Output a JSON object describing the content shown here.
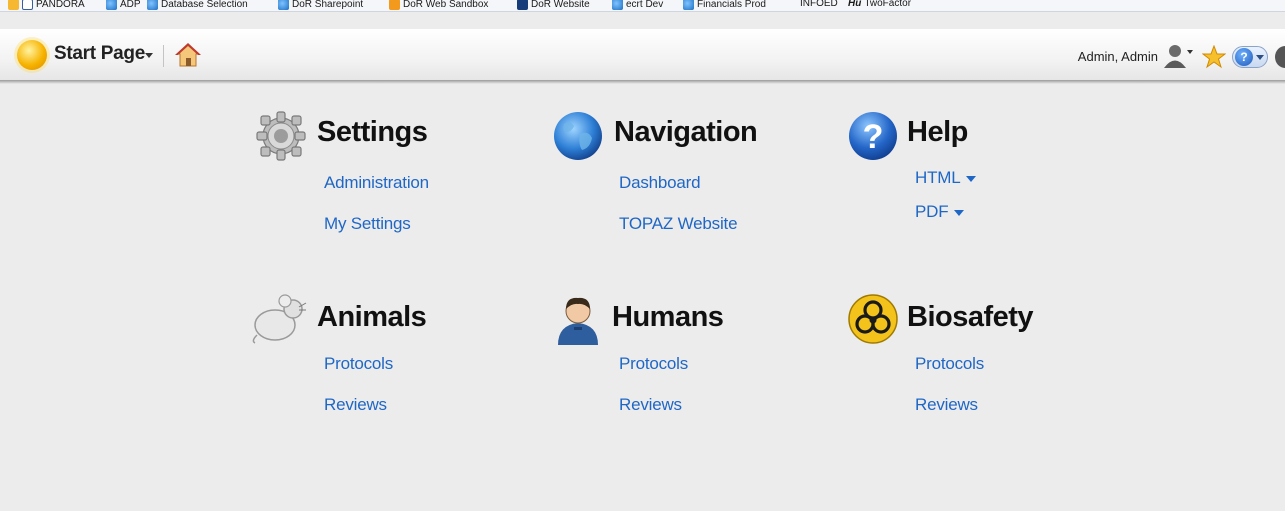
{
  "favorites_bar": {
    "items": [
      {
        "label": "PANDORA",
        "icon": "p-icon"
      },
      {
        "label": "ADP",
        "icon": "ie-icon"
      },
      {
        "label": "Database Selection",
        "icon": "ie-icon"
      },
      {
        "label": "DoR Sharepoint",
        "icon": "ie-icon"
      },
      {
        "label": "DoR Web Sandbox",
        "icon": "orange-icon"
      },
      {
        "label": "DoR Website",
        "icon": "hu-icon"
      },
      {
        "label": "ecrt Dev",
        "icon": "ie-icon"
      },
      {
        "label": "Financials Prod",
        "icon": "ie-icon"
      },
      {
        "label": "INFOED",
        "icon": ""
      },
      {
        "label": "TwoFactor",
        "icon": "hu-text-icon"
      }
    ]
  },
  "header": {
    "start_page_label": "Start Page",
    "user_name": "Admin, Admin"
  },
  "sections": {
    "settings": {
      "title": "Settings",
      "links": [
        "Administration",
        "My Settings"
      ]
    },
    "navigation": {
      "title": "Navigation",
      "links": [
        "Dashboard",
        "TOPAZ Website"
      ]
    },
    "help": {
      "title": "Help",
      "links": [
        "HTML",
        "PDF"
      ]
    },
    "animals": {
      "title": "Animals",
      "links": [
        "Protocols",
        "Reviews"
      ]
    },
    "humans": {
      "title": "Humans",
      "links": [
        "Protocols",
        "Reviews"
      ]
    },
    "biosafety": {
      "title": "Biosafety",
      "links": [
        "Protocols",
        "Reviews"
      ]
    }
  },
  "colors": {
    "link": "#1f67c6",
    "background": "#ececec"
  }
}
